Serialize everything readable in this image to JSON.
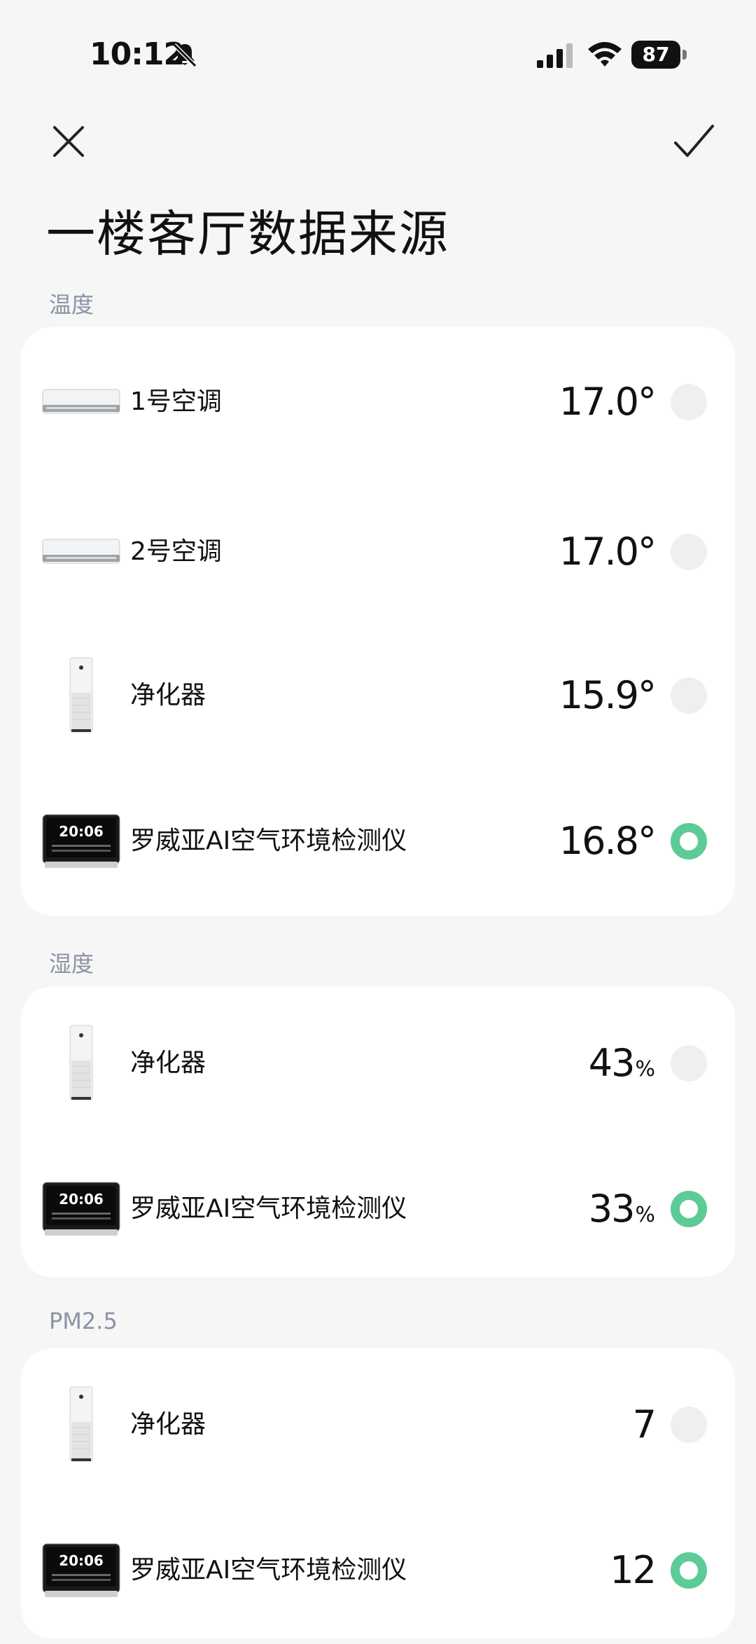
{
  "status_bar": {
    "time": "10:12",
    "battery": "87"
  },
  "header": {
    "title": "一楼客厅数据来源"
  },
  "colors": {
    "selected": "#5ccb96",
    "unselected": "#efefef",
    "section_label": "#8b93a4"
  },
  "sections": [
    {
      "label": "温度",
      "items": [
        {
          "name": "1号空调",
          "value": "17.0",
          "unit": "°",
          "icon": "air-conditioner",
          "selected": false
        },
        {
          "name": "2号空调",
          "value": "17.0",
          "unit": "°",
          "icon": "air-conditioner",
          "selected": false
        },
        {
          "name": "净化器",
          "value": "15.9",
          "unit": "°",
          "icon": "air-purifier",
          "selected": false
        },
        {
          "name": "罗威亚AI空气环境检测仪",
          "value": "16.8",
          "unit": "°",
          "icon": "air-monitor",
          "selected": true
        }
      ]
    },
    {
      "label": "湿度",
      "items": [
        {
          "name": "净化器",
          "value": "43",
          "unit": "%",
          "icon": "air-purifier",
          "selected": false
        },
        {
          "name": "罗威亚AI空气环境检测仪",
          "value": "33",
          "unit": "%",
          "icon": "air-monitor",
          "selected": true
        }
      ]
    },
    {
      "label": "PM2.5",
      "items": [
        {
          "name": "净化器",
          "value": "7",
          "unit": "",
          "icon": "air-purifier",
          "selected": false
        },
        {
          "name": "罗威亚AI空气环境检测仪",
          "value": "12",
          "unit": "",
          "icon": "air-monitor",
          "selected": true
        }
      ]
    }
  ],
  "monitor_screen": {
    "time": "20:06"
  }
}
